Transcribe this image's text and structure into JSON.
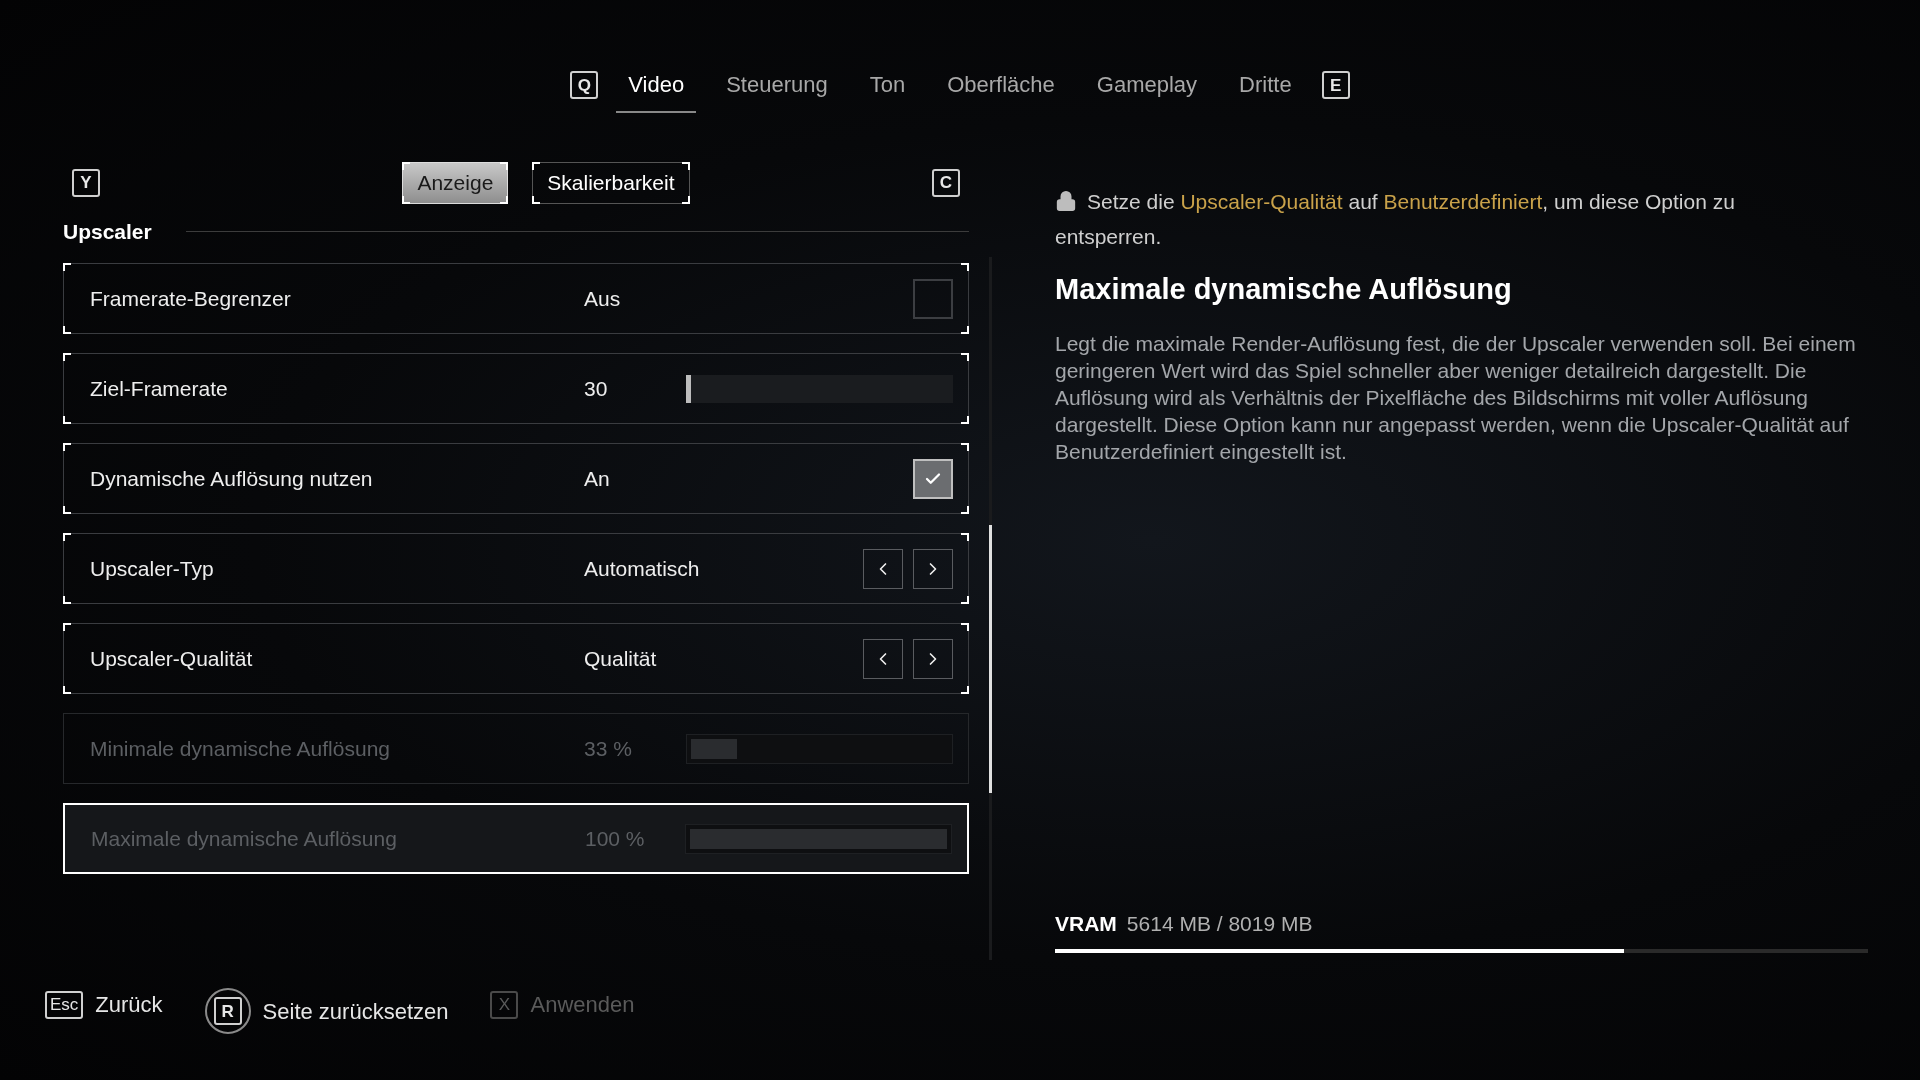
{
  "top_tabs": {
    "prev_key": "Q",
    "next_key": "E",
    "items": [
      {
        "label": "Video",
        "selected": true
      },
      {
        "label": "Steuerung",
        "selected": false
      },
      {
        "label": "Ton",
        "selected": false
      },
      {
        "label": "Oberfläche",
        "selected": false
      },
      {
        "label": "Gameplay",
        "selected": false
      },
      {
        "label": "Dritte",
        "selected": false
      }
    ]
  },
  "sub_tabs": {
    "prev_key": "Y",
    "next_key": "C",
    "items": [
      {
        "label": "Anzeige",
        "selected": true
      },
      {
        "label": "Skalierbarkeit",
        "selected": false
      }
    ]
  },
  "section": {
    "title": "Upscaler"
  },
  "settings": [
    {
      "kind": "toggle",
      "label": "Framerate-Begrenzer",
      "value": "Aus",
      "checked": false,
      "disabled": false,
      "selected": false
    },
    {
      "kind": "slider",
      "label": "Ziel-Framerate",
      "value": "30",
      "level": 0,
      "disabled": false,
      "selected": false
    },
    {
      "kind": "toggle",
      "label": "Dynamische Auflösung nutzen",
      "value": "An",
      "checked": true,
      "disabled": false,
      "selected": false
    },
    {
      "kind": "choice",
      "label": "Upscaler-Typ",
      "value": "Automatisch",
      "disabled": false,
      "selected": false
    },
    {
      "kind": "choice",
      "label": "Upscaler-Qualität",
      "value": "Qualität",
      "disabled": false,
      "selected": false
    },
    {
      "kind": "slider",
      "label": "Minimale dynamische Auflösung",
      "value": "33 %",
      "level": 0.18,
      "disabled": true,
      "selected": false
    },
    {
      "kind": "slider",
      "label": "Maximale dynamische Auflösung",
      "value": "100 %",
      "level": 1,
      "disabled": true,
      "selected": true
    }
  ],
  "details": {
    "lock_notice": "Setze die **Upscaler-Qualität** auf **Benutzerdefiniert**, um diese Option zu entsperren.",
    "title": "Maximale dynamische Auflösung",
    "description": "Legt die maximale Render-Auflösung fest, die der Upscaler verwenden soll. Bei einem geringeren Wert wird das Spiel schneller aber weniger detailreich dargestellt. Die Auflösung wird als Verhältnis der Pixelfläche des Bildschirms mit voller Auflösung dargestellt. Diese Option kann nur angepasst werden, wenn die Upscaler-Qualität auf Benutzerdefiniert eingestellt ist."
  },
  "vram": {
    "label": "VRAM",
    "reading": "5614 MB / 8019 MB",
    "level": 0.7
  },
  "footer": [
    {
      "kind": "key",
      "key": "Esc",
      "label": "Zurück",
      "disabled": false
    },
    {
      "kind": "round",
      "key": "R",
      "label": "Seite zurücksetzen",
      "disabled": false
    },
    {
      "kind": "key",
      "key": "X",
      "label": "Anwenden",
      "disabled": true
    }
  ]
}
